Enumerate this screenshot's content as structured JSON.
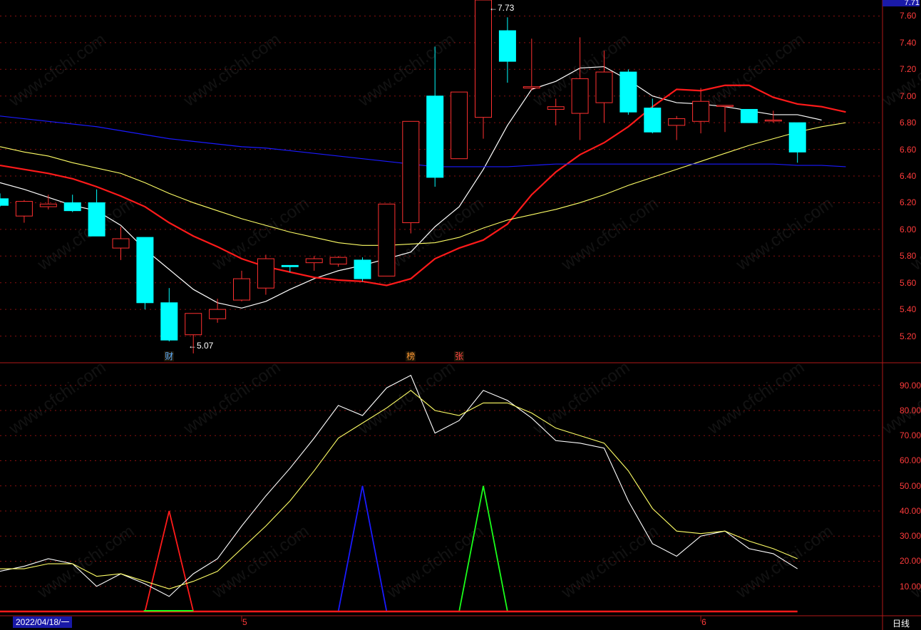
{
  "colors": {
    "background": "#000000",
    "grid": "#8a1010",
    "axis_text": "#ff3b3b",
    "candle_up": "#ff3030",
    "candle_down": "#00ffff",
    "ma_white": "#ffffff",
    "ma_red": "#ff1a1a",
    "ma_yellow": "#ffff66",
    "ma_blue": "#1a1aff",
    "k_line": "#ffffff",
    "d_line": "#ffff66"
  },
  "header": {
    "current_price_tag": "7.71"
  },
  "annotations": {
    "high_label": "7.73",
    "low_label": "5.07"
  },
  "event_badges": [
    {
      "text": "财",
      "index": 7,
      "color": "#5fb0ff"
    },
    {
      "text": "榜",
      "index": 17,
      "color": "#ff9933"
    },
    {
      "text": "张",
      "index": 19,
      "color": "#ff4444"
    }
  ],
  "footer": {
    "date": "2022/04/18/一",
    "month_labels": [
      {
        "text": "5",
        "index": 10
      },
      {
        "text": "6",
        "index": 29
      }
    ],
    "period": "日线"
  },
  "watermark": "www.cfchi.com",
  "chart_data": [
    {
      "type": "candlestick",
      "ylim": [
        5.0,
        7.72
      ],
      "y_ticks": [
        5.2,
        5.4,
        5.6,
        5.8,
        6.0,
        6.2,
        6.4,
        6.6,
        6.8,
        7.0,
        7.2,
        7.4,
        7.6
      ],
      "candles": [
        {
          "o": 6.23,
          "h": 6.27,
          "l": 6.17,
          "c": 6.18
        },
        {
          "o": 6.1,
          "h": 6.22,
          "l": 6.05,
          "c": 6.21
        },
        {
          "o": 6.17,
          "h": 6.26,
          "l": 6.15,
          "c": 6.19
        },
        {
          "o": 6.2,
          "h": 6.26,
          "l": 6.13,
          "c": 6.14
        },
        {
          "o": 6.2,
          "h": 6.3,
          "l": 5.95,
          "c": 5.95
        },
        {
          "o": 5.86,
          "h": 6.02,
          "l": 5.77,
          "c": 5.93
        },
        {
          "o": 5.94,
          "h": 5.94,
          "l": 5.4,
          "c": 5.45
        },
        {
          "o": 5.45,
          "h": 5.56,
          "l": 5.16,
          "c": 5.17
        },
        {
          "o": 5.21,
          "h": 5.37,
          "l": 5.07,
          "c": 5.37
        },
        {
          "o": 5.33,
          "h": 5.48,
          "l": 5.3,
          "c": 5.4
        },
        {
          "o": 5.47,
          "h": 5.69,
          "l": 5.46,
          "c": 5.63
        },
        {
          "o": 5.56,
          "h": 5.81,
          "l": 5.51,
          "c": 5.78
        },
        {
          "o": 5.73,
          "h": 5.73,
          "l": 5.68,
          "c": 5.72
        },
        {
          "o": 5.75,
          "h": 5.8,
          "l": 5.69,
          "c": 5.78
        },
        {
          "o": 5.74,
          "h": 5.8,
          "l": 5.72,
          "c": 5.79
        },
        {
          "o": 5.77,
          "h": 5.79,
          "l": 5.61,
          "c": 5.63
        },
        {
          "o": 5.65,
          "h": 6.19,
          "l": 5.65,
          "c": 6.19
        },
        {
          "o": 6.05,
          "h": 6.81,
          "l": 5.97,
          "c": 6.81
        },
        {
          "o": 7.0,
          "h": 7.37,
          "l": 6.32,
          "c": 6.39
        },
        {
          "o": 6.53,
          "h": 7.03,
          "l": 6.53,
          "c": 7.03
        },
        {
          "o": 6.84,
          "h": 7.73,
          "l": 6.68,
          "c": 7.72
        },
        {
          "o": 7.49,
          "h": 7.59,
          "l": 7.1,
          "c": 7.26
        },
        {
          "o": 7.06,
          "h": 7.43,
          "l": 7.04,
          "c": 7.07
        },
        {
          "o": 6.9,
          "h": 6.98,
          "l": 6.78,
          "c": 6.92
        },
        {
          "o": 6.87,
          "h": 7.44,
          "l": 6.67,
          "c": 7.13
        },
        {
          "o": 6.95,
          "h": 7.34,
          "l": 6.8,
          "c": 7.18
        },
        {
          "o": 7.18,
          "h": 7.2,
          "l": 6.86,
          "c": 6.88
        },
        {
          "o": 6.91,
          "h": 6.98,
          "l": 6.72,
          "c": 6.73
        },
        {
          "o": 6.78,
          "h": 6.85,
          "l": 6.67,
          "c": 6.83
        },
        {
          "o": 6.81,
          "h": 7.06,
          "l": 6.72,
          "c": 6.96
        },
        {
          "o": 6.93,
          "h": 6.93,
          "l": 6.73,
          "c": 6.93
        },
        {
          "o": 6.9,
          "h": 6.9,
          "l": 6.8,
          "c": 6.8
        },
        {
          "o": 6.82,
          "h": 6.89,
          "l": 6.8,
          "c": 6.82
        },
        {
          "o": 6.8,
          "h": 6.8,
          "l": 6.5,
          "c": 6.58
        }
      ],
      "moving_averages": [
        {
          "color": "#ffffff",
          "width": 1.2,
          "values": [
            6.35,
            6.3,
            6.24,
            6.18,
            6.14,
            6.03,
            5.85,
            5.7,
            5.55,
            5.45,
            5.41,
            5.46,
            5.55,
            5.63,
            5.69,
            5.73,
            5.78,
            5.83,
            6.02,
            6.17,
            6.45,
            6.78,
            7.05,
            7.11,
            7.21,
            7.22,
            7.12,
            7.0,
            6.95,
            6.94,
            6.92,
            6.89,
            6.86,
            6.86,
            6.82
          ]
        },
        {
          "color": "#ff1a1a",
          "width": 2.2,
          "values": [
            6.48,
            6.45,
            6.42,
            6.38,
            6.32,
            6.25,
            6.17,
            6.05,
            5.95,
            5.87,
            5.78,
            5.72,
            5.68,
            5.64,
            5.62,
            5.61,
            5.58,
            5.63,
            5.78,
            5.86,
            5.92,
            6.04,
            6.26,
            6.43,
            6.56,
            6.65,
            6.77,
            6.92,
            7.05,
            7.04,
            7.08,
            7.08,
            6.99,
            6.94,
            6.92,
            6.88
          ]
        },
        {
          "color": "#ffff66",
          "width": 1.1,
          "values": [
            6.62,
            6.58,
            6.55,
            6.5,
            6.46,
            6.42,
            6.35,
            6.27,
            6.2,
            6.14,
            6.08,
            6.03,
            5.98,
            5.94,
            5.9,
            5.88,
            5.88,
            5.89,
            5.9,
            5.94,
            6.01,
            6.07,
            6.11,
            6.15,
            6.2,
            6.26,
            6.33,
            6.39,
            6.45,
            6.51,
            6.57,
            6.63,
            6.68,
            6.73,
            6.77,
            6.8
          ]
        },
        {
          "color": "#1a1aff",
          "width": 1.2,
          "values": [
            6.85,
            6.83,
            6.81,
            6.79,
            6.77,
            6.74,
            6.71,
            6.68,
            6.66,
            6.64,
            6.62,
            6.61,
            6.59,
            6.57,
            6.55,
            6.53,
            6.51,
            6.49,
            6.47,
            6.47,
            6.47,
            6.47,
            6.48,
            6.49,
            6.49,
            6.49,
            6.49,
            6.49,
            6.49,
            6.49,
            6.49,
            6.49,
            6.49,
            6.48,
            6.48,
            6.47
          ]
        }
      ]
    },
    {
      "type": "line",
      "ylim": [
        0,
        99
      ],
      "y_ticks": [
        10,
        20,
        30,
        40,
        50,
        60,
        70,
        80,
        90
      ],
      "series": [
        {
          "color": "#ffffff",
          "values": [
            16,
            18,
            21,
            19,
            10,
            15,
            11,
            6,
            15,
            21,
            34,
            46,
            57,
            69,
            82,
            78,
            89,
            94,
            71,
            76,
            88,
            84,
            77,
            68,
            67,
            65,
            44,
            27,
            22,
            30,
            32,
            25,
            23,
            17
          ]
        },
        {
          "color": "#ffff66",
          "values": [
            17,
            17,
            19,
            19,
            14,
            15,
            12,
            9,
            12,
            16,
            25,
            34,
            44,
            56,
            69,
            75,
            81,
            88,
            80,
            78,
            83,
            83,
            79,
            73,
            70,
            67,
            56,
            41,
            32,
            31,
            32,
            28,
            25,
            21
          ]
        }
      ],
      "spikes": [
        {
          "index": 7,
          "height": 40,
          "color": "#ff1a1a"
        },
        {
          "index": 15,
          "height": 50,
          "color": "#1a1aff"
        },
        {
          "index": 20,
          "height": 50,
          "color": "#1aff1a"
        }
      ],
      "baseline": {
        "color": "#ff1a1a"
      },
      "green_segment": {
        "from": 6,
        "to": 8,
        "color": "#1aff1a"
      }
    }
  ]
}
